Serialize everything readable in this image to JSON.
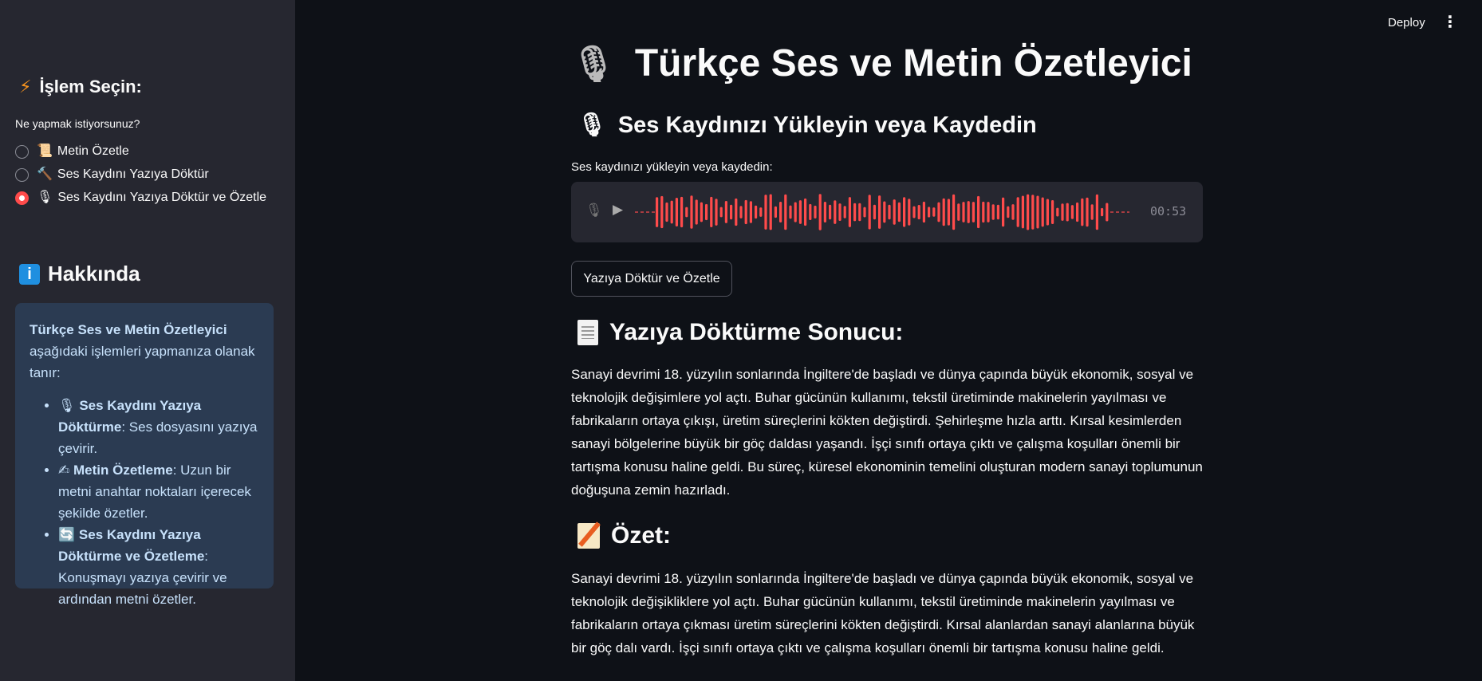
{
  "toolbar": {
    "deploy_label": "Deploy",
    "menu_glyph": "⋮"
  },
  "sidebar": {
    "header_icon": "⚡",
    "header": "İşlem Seçin:",
    "question": "Ne yapmak istiyorsunuz?",
    "options": [
      {
        "emoji": "📜",
        "label": "Metin Özetle",
        "checked": false
      },
      {
        "emoji": "🔨",
        "label": "Ses Kaydını Yazıya Döktür",
        "checked": false
      },
      {
        "emoji": "🎙",
        "label": "Ses Kaydını Yazıya Döktür ve Özetle",
        "checked": true
      }
    ],
    "about_icon": "i",
    "about_header": "Hakkında",
    "about": {
      "intro_bold": "Türkçe Ses ve Metin Özetleyici",
      "intro_rest": " aşağıdaki işlemleri yapmanıza olanak tanır:",
      "items": [
        {
          "emoji": "🎙",
          "title": "Ses Kaydını Yazıya Döktürme",
          "desc": ": Ses dosyasını yazıya çevirir."
        },
        {
          "emoji": "✍",
          "title": "Metin Özetleme",
          "desc": ": Uzun bir metni anahtar noktaları içerecek şekilde özetler."
        },
        {
          "emoji": "🔄",
          "title": "Ses Kaydını Yazıya Döktürme ve Özetleme",
          "desc": ": Konuşmayı yazıya çevirir ve ardından metni özetler."
        }
      ]
    }
  },
  "main": {
    "title_icon": "🎙",
    "title": "Türkçe Ses ve Metin Özetleyici",
    "subtitle_icon": "🎙",
    "subtitle": "Ses Kaydınızı Yükleyin veya Kaydedin",
    "upload_label": "Ses kaydınızı yükleyin veya kaydedin:",
    "audio": {
      "time": "00:53",
      "mic_glyph": "🎙",
      "play_glyph": "▶",
      "accent_color": "#ff4b4b"
    },
    "action_button": "Yazıya Döktür ve Özetle",
    "transcript_header": "Yazıya Döktürme Sonucu:",
    "transcript_text": "Sanayi devrimi 18. yüzyılın sonlarında İngiltere'de başladı ve dünya çapında büyük ekonomik, sosyal ve teknolojik değişimlere yol açtı. Buhar gücünün kullanımı, tekstil üretiminde makinelerin yayılması ve fabrikaların ortaya çıkışı, üretim süreçlerini kökten değiştirdi. Şehirleşme hızla arttı. Kırsal kesimlerden sanayi bölgelerine büyük bir göç daldası yaşandı. İşçi sınıfı ortaya çıktı ve çalışma koşulları önemli bir tartışma konusu haline geldi. Bu süreç, küresel ekonominin temelini oluşturan modern sanayi toplumunun doğuşuna zemin hazırladı.",
    "summary_header": "Özet:",
    "summary_text": "Sanayi devrimi 18. yüzyılın sonlarında İngiltere'de başladı ve dünya çapında büyük ekonomik, sosyal ve teknolojik değişikliklere yol açtı. Buhar gücünün kullanımı, tekstil üretiminde makinelerin yayılması ve fabrikaların ortaya çıkması üretim süreçlerini kökten değiştirdi. Kırsal alanlardan sanayi alanlarına büyük bir göç dalı vardı. İşçi sınıfı ortaya çıktı ve çalışma koşulları önemli bir tartışma konusu haline geldi."
  }
}
